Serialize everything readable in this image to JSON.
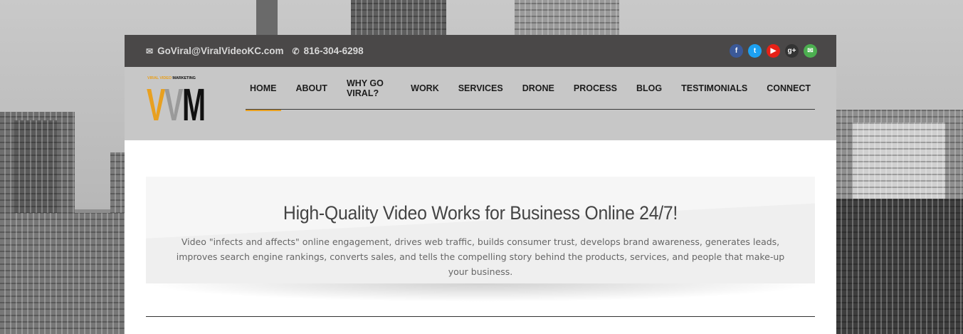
{
  "topbar": {
    "email": "GoViral@ViralVideoKC.com",
    "phone": "816-304-6298",
    "socials": [
      {
        "name": "facebook",
        "glyph": "f",
        "color": "#3b5998"
      },
      {
        "name": "twitter",
        "glyph": "t",
        "color": "#1da1f2"
      },
      {
        "name": "youtube",
        "glyph": "▶",
        "color": "#e62117"
      },
      {
        "name": "google-plus",
        "glyph": "g+",
        "color": "#333333"
      },
      {
        "name": "email",
        "glyph": "✉",
        "color": "#4caf50"
      }
    ]
  },
  "logo": {
    "tagline_yellow": "VIRAL VIDEO",
    "tagline_black": "MARKETING",
    "letters": [
      "V",
      "V",
      "M"
    ],
    "colors": [
      "#e8a020",
      "#9a9a9a",
      "#111111"
    ]
  },
  "nav": {
    "items": [
      "HOME",
      "ABOUT",
      "WHY GO VIRAL?",
      "WORK",
      "SERVICES",
      "DRONE",
      "PROCESS",
      "BLOG",
      "TESTIMONIALS",
      "CONNECT"
    ],
    "active_index": 0,
    "accent": "#e8a020"
  },
  "hero": {
    "title": "High-Quality Video Works for Business Online 24/7!",
    "body": "Video \"infects and affects\" online engagement, drives web traffic, builds consumer trust, develops brand awareness, generates leads, improves search engine rankings, converts sales, and tells the compelling story behind the products, services, and people that make-up your business."
  }
}
